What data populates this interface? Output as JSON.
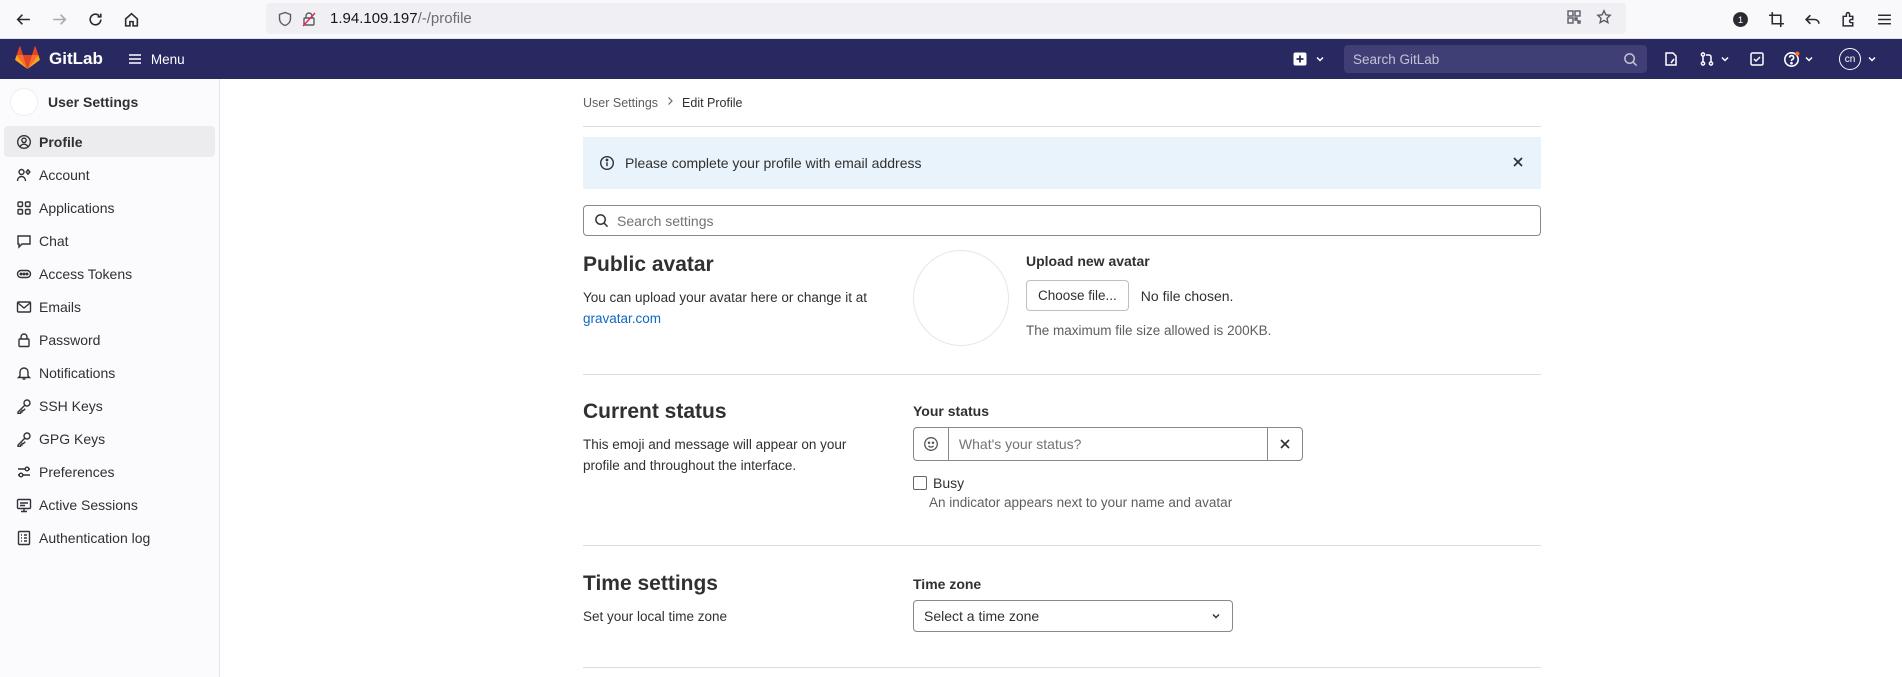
{
  "browser": {
    "url_host": "1.94.109.197",
    "url_path": "/-/profile"
  },
  "topbar": {
    "logo_text": "GitLab",
    "menu_label": "Menu",
    "search_placeholder": "Search GitLab",
    "avatar_initials": "cn",
    "nav_bg": "#292961"
  },
  "sidebar": {
    "title": "User Settings",
    "items": [
      {
        "label": "Profile",
        "icon": "user-icon",
        "active": true
      },
      {
        "label": "Account",
        "icon": "account-icon"
      },
      {
        "label": "Applications",
        "icon": "applications-icon"
      },
      {
        "label": "Chat",
        "icon": "comment-icon"
      },
      {
        "label": "Access Tokens",
        "icon": "token-icon"
      },
      {
        "label": "Emails",
        "icon": "mail-icon"
      },
      {
        "label": "Password",
        "icon": "lock-icon"
      },
      {
        "label": "Notifications",
        "icon": "bell-icon"
      },
      {
        "label": "SSH Keys",
        "icon": "key-icon"
      },
      {
        "label": "GPG Keys",
        "icon": "key-icon"
      },
      {
        "label": "Preferences",
        "icon": "preferences-icon"
      },
      {
        "label": "Active Sessions",
        "icon": "monitor-icon"
      },
      {
        "label": "Authentication log",
        "icon": "log-icon"
      }
    ]
  },
  "breadcrumb": {
    "parent": "User Settings",
    "current": "Edit Profile"
  },
  "alert": {
    "message": "Please complete your profile with email address"
  },
  "settings_search": {
    "placeholder": "Search settings"
  },
  "public_avatar": {
    "title": "Public avatar",
    "description": "You can upload your avatar here or change it at",
    "link": "gravatar.com",
    "upload_title": "Upload new avatar",
    "choose_button": "Choose file...",
    "no_file": "No file chosen.",
    "max_size": "The maximum file size allowed is 200KB."
  },
  "current_status": {
    "title": "Current status",
    "description": "This emoji and message will appear on your profile and throughout the interface.",
    "label": "Your status",
    "placeholder": "What's your status?",
    "busy_label": "Busy",
    "busy_help": "An indicator appears next to your name and avatar"
  },
  "time_settings": {
    "title": "Time settings",
    "description": "Set your local time zone",
    "label": "Time zone",
    "select_value": "Select a time zone"
  }
}
